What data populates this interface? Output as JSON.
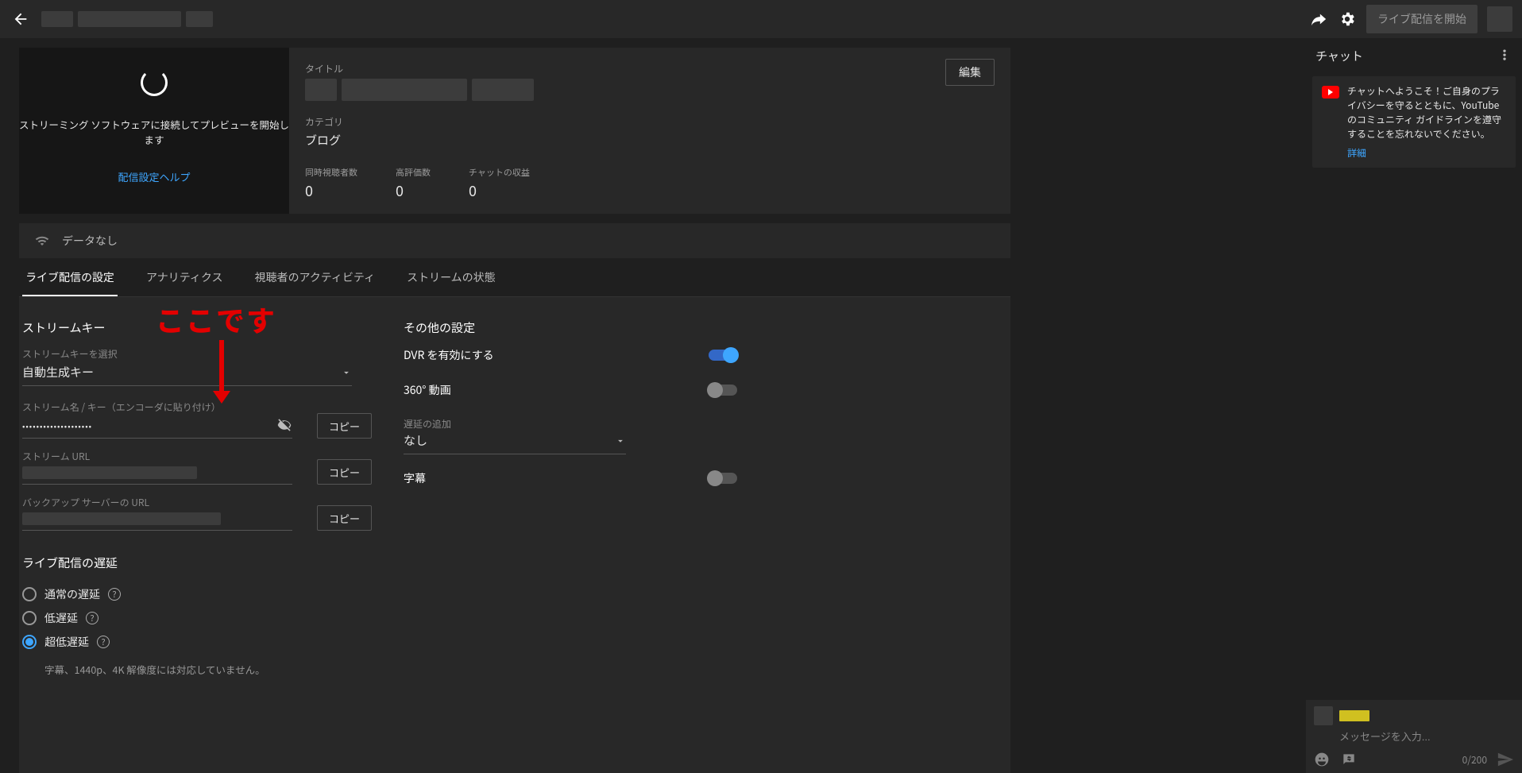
{
  "topbar": {
    "start_live_label": "ライブ配信を開始"
  },
  "preview": {
    "connect_msg": "ストリーミング ソフトウェアに接続してプレビューを開始します",
    "help_link": "配信設定ヘルプ"
  },
  "info": {
    "title_label": "タイトル",
    "category_label": "カテゴリ",
    "category_value": "ブログ",
    "edit_button": "編集",
    "stats": {
      "viewers_label": "同時視聴者数",
      "viewers_value": "0",
      "likes_label": "高評価数",
      "likes_value": "0",
      "chat_rev_label": "チャットの収益",
      "chat_rev_value": "0"
    }
  },
  "status": {
    "text": "データなし"
  },
  "tabs": {
    "settings": "ライブ配信の設定",
    "analytics": "アナリティクス",
    "activity": "視聴者のアクティビティ",
    "health": "ストリームの状態"
  },
  "annotation": {
    "text": "ここです"
  },
  "stream": {
    "section_title": "ストリームキー",
    "select_key_label": "ストリームキーを選択",
    "select_key_value": "自動生成キー",
    "name_key_label": "ストリーム名 / キー（エンコーダに貼り付け）",
    "name_key_value": "••••••••••••••••••••",
    "url_label": "ストリーム URL",
    "backup_label": "バックアップ サーバーの URL",
    "copy_button": "コピー"
  },
  "latency": {
    "section_title": "ライブ配信の遅延",
    "normal": "通常の遅延",
    "low": "低遅延",
    "ultralow": "超低遅延",
    "note": "字幕、1440p、4K 解像度には対応していません。"
  },
  "other": {
    "section_title": "その他の設定",
    "dvr_label": "DVR を有効にする",
    "v360_label": "360° 動画",
    "delay_add_label": "遅延の追加",
    "delay_add_value": "なし",
    "captions_label": "字幕"
  },
  "chat": {
    "header": "チャット",
    "welcome_text": "チャットへようこそ！ご自身のプライバシーを守るとともに、YouTube のコミュニティ ガイドラインを遵守することを忘れないでください。",
    "more_link": "詳細",
    "input_placeholder": "メッセージを入力...",
    "counter": "0/200"
  }
}
